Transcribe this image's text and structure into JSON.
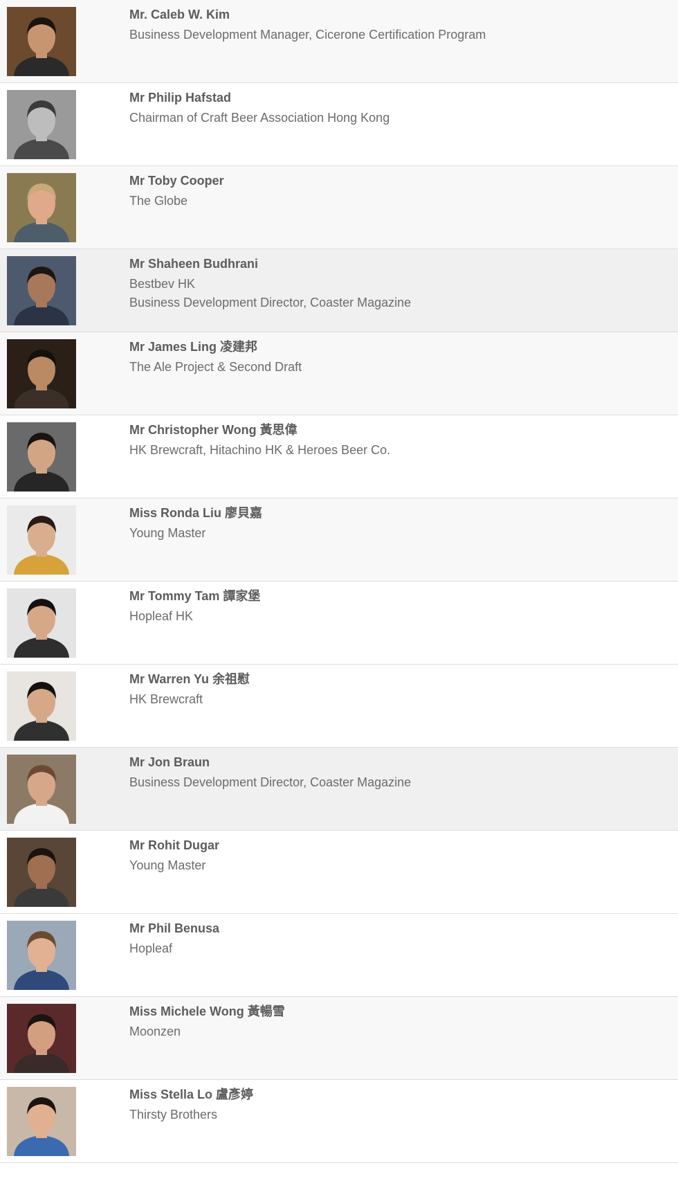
{
  "speakers": [
    {
      "name": "Mr. Caleb W. Kim",
      "lines": [
        "Business Development Manager, Cicerone Certification Program"
      ],
      "photo": {
        "bg": "#6b4a2e",
        "skin": "#c79570",
        "hair": "#1a1410",
        "shirt": "#2a2a2a"
      }
    },
    {
      "name": "Mr Philip Hafstad",
      "lines": [
        "Chairman of Craft Beer Association Hong Kong"
      ],
      "photo": {
        "bg": "#9a9a9a",
        "skin": "#bdbdbd",
        "hair": "#3a3a3a",
        "shirt": "#4a4a4a"
      }
    },
    {
      "name": "Mr Toby Cooper",
      "lines": [
        "The Globe"
      ],
      "photo": {
        "bg": "#8a7a52",
        "skin": "#e0a98a",
        "hair": "#c9a97a",
        "shirt": "#4d5d6a"
      }
    },
    {
      "name": "Mr Shaheen Budhrani",
      "lines": [
        "Bestbev HK",
        "Business Development Director, Coaster Magazine"
      ],
      "photo": {
        "bg": "#4d5a6e",
        "skin": "#a8785a",
        "hair": "#1c1612",
        "shirt": "#2b3447"
      }
    },
    {
      "name": "Mr James Ling 凌建邦",
      "lines": [
        "The Ale Project & Second Draft"
      ],
      "photo": {
        "bg": "#2a2018",
        "skin": "#b98a64",
        "hair": "#14100c",
        "shirt": "#3a3028"
      }
    },
    {
      "name": "Mr Christopher Wong 黃思偉",
      "lines": [
        "HK Brewcraft, Hitachino HK & Heroes Beer Co."
      ],
      "photo": {
        "bg": "#6a6a6a",
        "skin": "#d2a684",
        "hair": "#181410",
        "shirt": "#262626"
      }
    },
    {
      "name": "Miss Ronda Liu 廖貝嘉",
      "lines": [
        "Young Master"
      ],
      "photo": {
        "bg": "#eaeaea",
        "skin": "#d9ae8e",
        "hair": "#2a1a14",
        "shirt": "#d7a23a"
      }
    },
    {
      "name": "Mr Tommy Tam 譚家堡",
      "lines": [
        "Hopleaf HK"
      ],
      "photo": {
        "bg": "#e4e4e4",
        "skin": "#d6a888",
        "hair": "#141010",
        "shirt": "#2e2e2e"
      }
    },
    {
      "name": "Mr Warren Yu 余祖慰",
      "lines": [
        "HK Brewcraft"
      ],
      "photo": {
        "bg": "#e8e4df",
        "skin": "#d6a888",
        "hair": "#141010",
        "shirt": "#303030"
      }
    },
    {
      "name": "Mr Jon Braun",
      "lines": [
        "Business Development Director, Coaster Magazine"
      ],
      "photo": {
        "bg": "#8c7a66",
        "skin": "#d7a78a",
        "hair": "#6b4a32",
        "shirt": "#f2f2f2"
      }
    },
    {
      "name": "Mr Rohit Dugar",
      "lines": [
        "Young Master"
      ],
      "photo": {
        "bg": "#5a4636",
        "skin": "#a06e50",
        "hair": "#1a1410",
        "shirt": "#3a3a3a"
      }
    },
    {
      "name": "Mr Phil Benusa",
      "lines": [
        "Hopleaf"
      ],
      "photo": {
        "bg": "#9aa8b8",
        "skin": "#e2b194",
        "hair": "#6a4a30",
        "shirt": "#2f4a7a"
      }
    },
    {
      "name": "Miss Michele Wong 黃暢雪",
      "lines": [
        "Moonzen"
      ],
      "photo": {
        "bg": "#5a2a2a",
        "skin": "#d2a080",
        "hair": "#1c1410",
        "shirt": "#3a2a2a"
      }
    },
    {
      "name": "Miss Stella Lo 盧彥婷",
      "lines": [
        "Thirsty Brothers"
      ],
      "photo": {
        "bg": "#c8b8a8",
        "skin": "#e0b090",
        "hair": "#1a1410",
        "shirt": "#3a6ab0"
      }
    }
  ]
}
